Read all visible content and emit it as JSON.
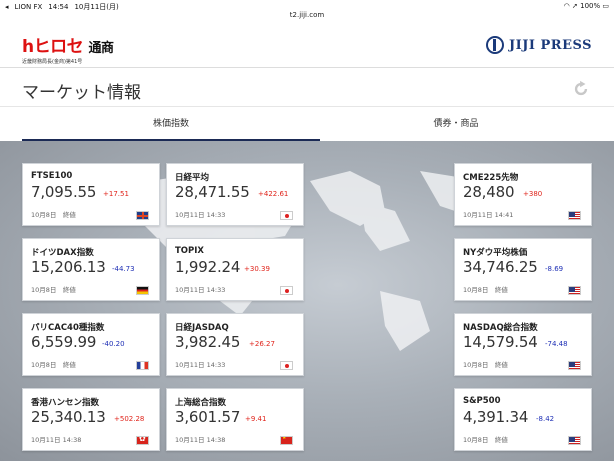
{
  "status": {
    "carrier": "LION FX",
    "time": "14:54",
    "date": "10月11日(月)",
    "battery": "100%"
  },
  "url": "t2.jiji.com",
  "brand_left": {
    "mark_h": "h",
    "mark_rest": "ヒロセ",
    "mark_kanji": "通商",
    "sub": "近畿財務局長(金商)第41号"
  },
  "brand_right": {
    "name": "JIJI PRESS"
  },
  "page_title": "マーケット情報",
  "tabs": [
    {
      "label": "株価指数"
    },
    {
      "label": "債券・商品"
    }
  ],
  "cards": [
    {
      "name": "FTSE100",
      "value": "7,095.55",
      "change": "+17.51",
      "dir": "up",
      "time": "10月8日　終値",
      "flag": "uk"
    },
    {
      "name": "日経平均",
      "value": "28,471.55",
      "change": "+422.61",
      "dir": "up",
      "time": "10月11日 14:33",
      "flag": "jp"
    },
    {
      "name": "CME225先物",
      "value": "28,480",
      "change": "+380",
      "dir": "up",
      "time": "10月11日 14:41",
      "flag": "us"
    },
    {
      "name": "ドイツDAX指数",
      "value": "15,206.13",
      "change": "-44.73",
      "dir": "down",
      "time": "10月8日　終値",
      "flag": "de"
    },
    {
      "name": "TOPIX",
      "value": "1,992.24",
      "change": "+30.39",
      "dir": "up",
      "time": "10月11日 14:33",
      "flag": "jp"
    },
    {
      "name": "NYダウ平均株価",
      "value": "34,746.25",
      "change": "-8.69",
      "dir": "down",
      "time": "10月8日　終値",
      "flag": "us"
    },
    {
      "name": "パリCAC40種指数",
      "value": "6,559.99",
      "change": "-40.20",
      "dir": "down",
      "time": "10月8日　終値",
      "flag": "fr"
    },
    {
      "name": "日経JASDAQ",
      "value": "3,982.45",
      "change": "+26.27",
      "dir": "up",
      "time": "10月11日 14:33",
      "flag": "jp"
    },
    {
      "name": "NASDAQ総合指数",
      "value": "14,579.54",
      "change": "-74.48",
      "dir": "down",
      "time": "10月8日　終値",
      "flag": "us"
    },
    {
      "name": "香港ハンセン指数",
      "value": "25,340.13",
      "change": "+502.28",
      "dir": "up",
      "time": "10月11日 14:38",
      "flag": "hk"
    },
    {
      "name": "上海総合指数",
      "value": "3,601.57",
      "change": "+9.41",
      "dir": "up",
      "time": "10月11日 14:38",
      "flag": "cn"
    },
    {
      "name": "S&P500",
      "value": "4,391.34",
      "change": "-8.42",
      "dir": "down",
      "time": "10月8日　終値",
      "flag": "us"
    }
  ],
  "colors": {
    "up": "#e0241b",
    "down": "#1e2fb5",
    "tab_underline": "#1b2a55",
    "brand_red": "#d11111",
    "jiji_blue": "#1b3a7a"
  }
}
